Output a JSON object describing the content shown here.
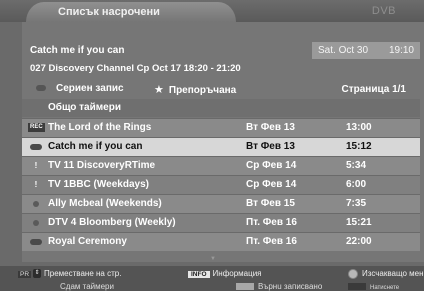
{
  "header": {
    "title": "Списък насрочени",
    "logo": "DVB"
  },
  "info": {
    "program_title": "Catch me if you can",
    "date": "Sat. Oct 30",
    "time": "19:10",
    "channel_line": "027 Discovery Channel Cp Oct 17    18:20 - 21:20"
  },
  "legend": {
    "series": "Сериен запис",
    "recommended": "Препоръчана",
    "page": "Страница 1/1"
  },
  "all_timers_label": "Общо таймери",
  "rows": [
    {
      "icon": "REC",
      "name": "The Lord of the Rings",
      "date": "Вт Фев 13",
      "time": "13:00",
      "selected": false
    },
    {
      "icon": "pill",
      "name": "Catch me if you can",
      "date": "Вт Фев 13",
      "time": "15:12",
      "selected": true
    },
    {
      "icon": "!",
      "name": "TV  11 DiscoveryRTime",
      "date": "Ср Фев 14",
      "time": "5:34",
      "selected": false
    },
    {
      "icon": "!",
      "name": "TV  1BBC (Weekdays)",
      "date": "Ср Фев 14",
      "time": "6:00",
      "selected": false
    },
    {
      "icon": "circle",
      "name": "Ally Mcbeal (Weekends)",
      "date": "Вт Фев 15",
      "time": "7:35",
      "selected": false
    },
    {
      "icon": "circle",
      "name": "DTV 4 Bloomberg (Weekly)",
      "date": "Пт. Фев 16",
      "time": "15:21",
      "selected": false
    },
    {
      "icon": "pill",
      "name": "Royal Ceremony",
      "date": "Пт. Фев 16",
      "time": "22:00",
      "selected": false
    }
  ],
  "footer": {
    "pr_key": "PR",
    "move_label": "Преместване на стр.",
    "info_key": "INFO",
    "info_label": "Информация",
    "delete_label": "Изсчакващо меню",
    "all_timers_btn": "Сдам таймери",
    "back_label": "Върнu записвано",
    "extra_label": "Натиснете"
  }
}
